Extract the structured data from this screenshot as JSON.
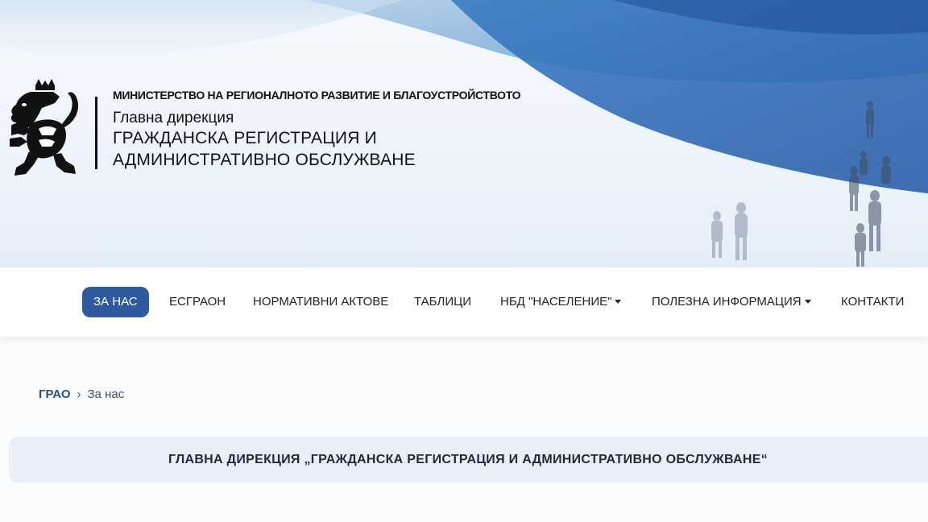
{
  "header": {
    "ministry": "МИНИСТЕРСТВО НА РЕГИОНАЛНОТО РАЗВИТИЕ И БЛАГОУСТРОЙСТВОТО",
    "directorate_label": "Главна дирекция",
    "directorate_name_line1": "ГРАЖДАНСКА РЕГИСТРАЦИЯ И",
    "directorate_name_line2": "АДМИНИСТРАТИВНО ОБСЛУЖВАНЕ",
    "logo_icon": "bulgarian-lion-coat-of-arms-icon"
  },
  "nav": {
    "items": [
      {
        "label": "ЗА НАС",
        "active": true
      },
      {
        "label": "ЕСГРАОН"
      },
      {
        "label": "НОРМАТИВНИ АКТОВЕ"
      },
      {
        "label": "ТАБЛИЦИ"
      },
      {
        "label": "НБД \"НАСЕЛЕНИЕ\"",
        "dropdown": true
      },
      {
        "label": "ПОЛЕЗНА ИНФОРМАЦИЯ",
        "dropdown": true
      },
      {
        "label": "КОНТАКТИ"
      }
    ]
  },
  "breadcrumb": {
    "home": "ГРАО",
    "separator": "›",
    "current": "За нас"
  },
  "page": {
    "title": "ГЛАВНА ДИРЕКЦИЯ „ГРАЖДАНСКА РЕГИСТРАЦИЯ И АДМИНИСТРАТИВНО ОБСЛУЖВАНЕ“"
  },
  "colors": {
    "accent": "#2f5a9e",
    "breadcrumb_link": "#2a4f8a",
    "title_bar_bg": "#e8eff9"
  }
}
